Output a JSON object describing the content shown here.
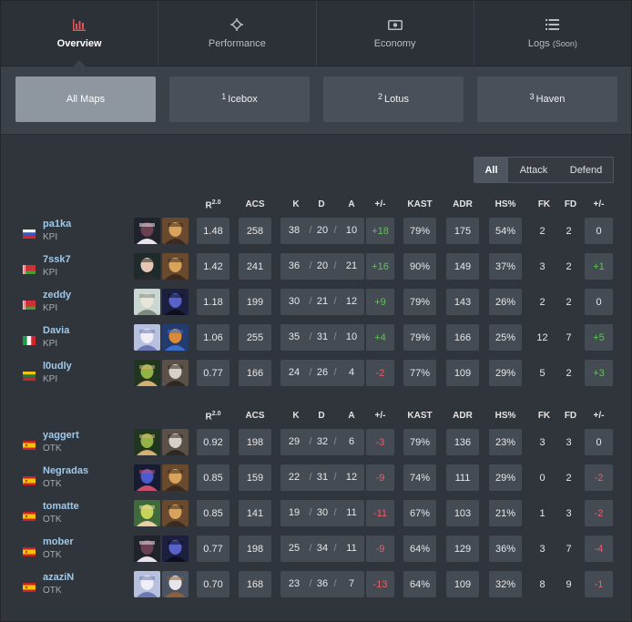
{
  "tabs": [
    {
      "label": "Overview",
      "icon": "bar-chart-icon",
      "active": true
    },
    {
      "label": "Performance",
      "icon": "crosshair-icon",
      "active": false
    },
    {
      "label": "Economy",
      "icon": "money-icon",
      "active": false
    },
    {
      "label": "Logs",
      "soon": "(Soon)",
      "icon": "list-icon",
      "active": false
    }
  ],
  "maps": [
    {
      "num": "",
      "label": "All Maps",
      "active": true
    },
    {
      "num": "1",
      "label": "Icebox",
      "active": false
    },
    {
      "num": "2",
      "label": "Lotus",
      "active": false
    },
    {
      "num": "3",
      "label": "Haven",
      "active": false
    }
  ],
  "side_filter": {
    "all": "All",
    "attack": "Attack",
    "defend": "Defend",
    "selected": "All"
  },
  "columns": {
    "rating": "R",
    "rating_sup": "2.0",
    "acs": "ACS",
    "k": "K",
    "d": "D",
    "a": "A",
    "pm": "+/-",
    "kast": "KAST",
    "adr": "ADR",
    "hs": "HS%",
    "fk": "FK",
    "fd": "FD",
    "fkfd_pm": "+/-"
  },
  "colors": {
    "positive": "#5fc35a",
    "negative": "#ea5f6a",
    "player_name": "#9fc9ea",
    "active_tab_accent": "#e0565b"
  },
  "teams": [
    {
      "players": [
        {
          "name": "pa1ka",
          "team": "KPI",
          "flag": "russia",
          "agents": [
            "agent-a",
            "agent-b"
          ],
          "rating": "1.48",
          "acs": "258",
          "k": "38",
          "d": "20",
          "a": "10",
          "pm": "+18",
          "kast": "79%",
          "adr": "175",
          "hs": "54%",
          "fk": "2",
          "fd": "2",
          "fkpm": "0"
        },
        {
          "name": "7ssk7",
          "team": "KPI",
          "flag": "belarus",
          "agents": [
            "agent-c",
            "agent-b"
          ],
          "rating": "1.42",
          "acs": "241",
          "k": "36",
          "d": "20",
          "a": "21",
          "pm": "+16",
          "kast": "90%",
          "adr": "149",
          "hs": "37%",
          "fk": "3",
          "fd": "2",
          "fkpm": "+1"
        },
        {
          "name": "zeddy",
          "team": "KPI",
          "flag": "belarus",
          "agents": [
            "agent-d",
            "agent-e"
          ],
          "rating": "1.18",
          "acs": "199",
          "k": "30",
          "d": "21",
          "a": "12",
          "pm": "+9",
          "kast": "79%",
          "adr": "143",
          "hs": "26%",
          "fk": "2",
          "fd": "2",
          "fkpm": "0"
        },
        {
          "name": "Davia",
          "team": "KPI",
          "flag": "italy",
          "agents": [
            "agent-f",
            "agent-g"
          ],
          "rating": "1.06",
          "acs": "255",
          "k": "35",
          "d": "31",
          "a": "10",
          "pm": "+4",
          "kast": "79%",
          "adr": "166",
          "hs": "25%",
          "fk": "12",
          "fd": "7",
          "fkpm": "+5"
        },
        {
          "name": "l0udly",
          "team": "KPI",
          "flag": "lithuania",
          "agents": [
            "agent-h",
            "agent-i"
          ],
          "rating": "0.77",
          "acs": "166",
          "k": "24",
          "d": "26",
          "a": "4",
          "pm": "-2",
          "kast": "77%",
          "adr": "109",
          "hs": "29%",
          "fk": "5",
          "fd": "2",
          "fkpm": "+3"
        }
      ]
    },
    {
      "players": [
        {
          "name": "yaggert",
          "team": "OTK",
          "flag": "spain",
          "agents": [
            "agent-h",
            "agent-i"
          ],
          "rating": "0.92",
          "acs": "198",
          "k": "29",
          "d": "32",
          "a": "6",
          "pm": "-3",
          "kast": "79%",
          "adr": "136",
          "hs": "23%",
          "fk": "3",
          "fd": "3",
          "fkpm": "0"
        },
        {
          "name": "Negradas",
          "team": "OTK",
          "flag": "spain",
          "agents": [
            "agent-j",
            "agent-b"
          ],
          "rating": "0.85",
          "acs": "159",
          "k": "22",
          "d": "31",
          "a": "12",
          "pm": "-9",
          "kast": "74%",
          "adr": "111",
          "hs": "29%",
          "fk": "0",
          "fd": "2",
          "fkpm": "-2"
        },
        {
          "name": "tomatte",
          "team": "OTK",
          "flag": "spain",
          "agents": [
            "agent-k",
            "agent-b"
          ],
          "rating": "0.85",
          "acs": "141",
          "k": "19",
          "d": "30",
          "a": "11",
          "pm": "-11",
          "kast": "67%",
          "adr": "103",
          "hs": "21%",
          "fk": "1",
          "fd": "3",
          "fkpm": "-2"
        },
        {
          "name": "mober",
          "team": "OTK",
          "flag": "spain",
          "agents": [
            "agent-a",
            "agent-e"
          ],
          "rating": "0.77",
          "acs": "198",
          "k": "25",
          "d": "34",
          "a": "11",
          "pm": "-9",
          "kast": "64%",
          "adr": "129",
          "hs": "36%",
          "fk": "3",
          "fd": "7",
          "fkpm": "-4"
        },
        {
          "name": "azaziN",
          "team": "OTK",
          "flag": "spain",
          "agents": [
            "agent-f",
            "agent-l"
          ],
          "rating": "0.70",
          "acs": "168",
          "k": "23",
          "d": "36",
          "a": "7",
          "pm": "-13",
          "kast": "64%",
          "adr": "109",
          "hs": "32%",
          "fk": "8",
          "fd": "9",
          "fkpm": "-1"
        }
      ]
    }
  ]
}
